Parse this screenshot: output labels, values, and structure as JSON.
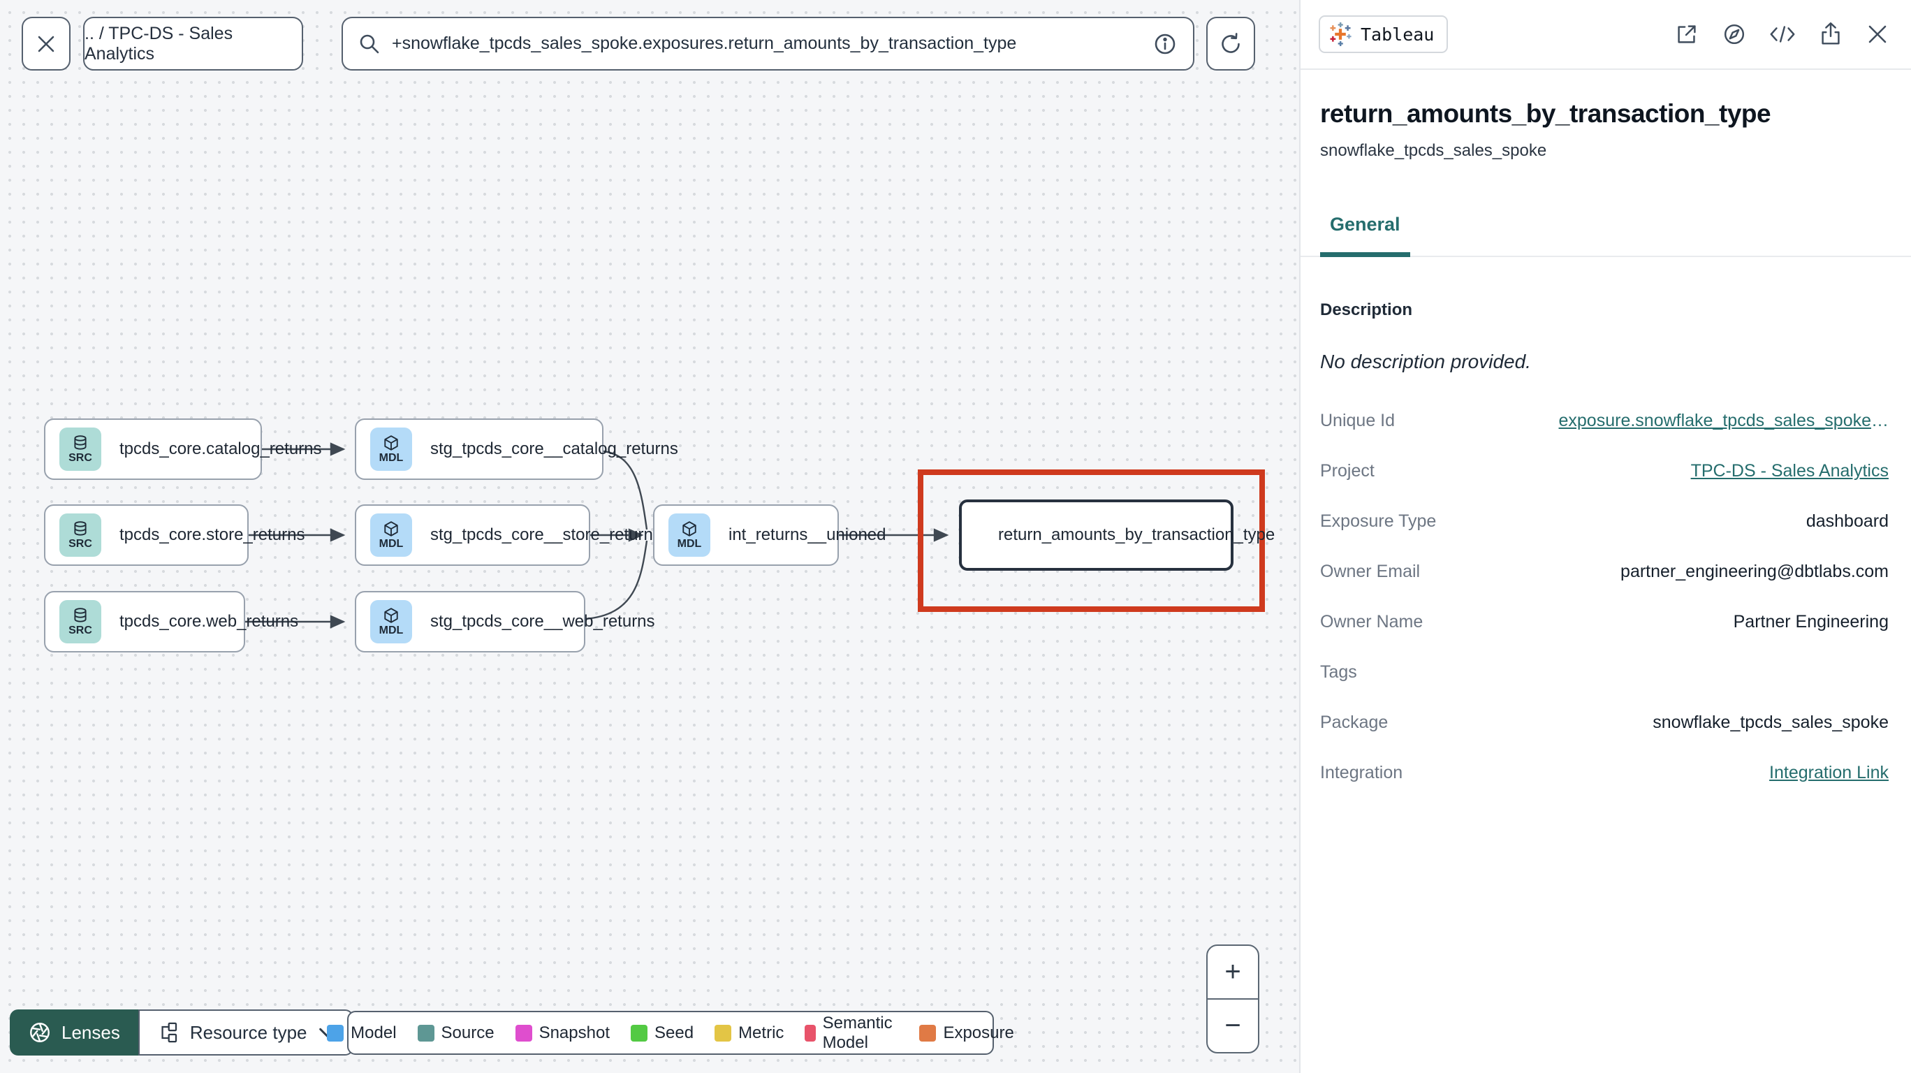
{
  "toolbar": {
    "breadcrumb": ".. / TPC-DS - Sales Analytics",
    "search_value": "+snowflake_tpcds_sales_spoke.exposures.return_amounts_by_transaction_type"
  },
  "graph": {
    "nodes": [
      {
        "badge": "SRC",
        "label": "tpcds_core.catalog_returns"
      },
      {
        "badge": "SRC",
        "label": "tpcds_core.store_returns"
      },
      {
        "badge": "SRC",
        "label": "tpcds_core.web_returns"
      },
      {
        "badge": "MDL",
        "label": "stg_tpcds_core__catalog_returns"
      },
      {
        "badge": "MDL",
        "label": "stg_tpcds_core__store_returns"
      },
      {
        "badge": "MDL",
        "label": "stg_tpcds_core__web_returns"
      },
      {
        "badge": "MDL",
        "label": "int_returns__unioned"
      }
    ],
    "exposure_node": {
      "label": "return_amounts_by_transaction_type",
      "icon": "tableau-logo"
    },
    "highlight_color": "#cf3a1e"
  },
  "controls": {
    "lenses_label": "Lenses",
    "resource_type_label": "Resource type",
    "zoom_in": "+",
    "zoom_out": "−"
  },
  "legend": {
    "items": [
      {
        "label": "Model",
        "color": "#4da3e8"
      },
      {
        "label": "Source",
        "color": "#5e9794"
      },
      {
        "label": "Snapshot",
        "color": "#df4ece"
      },
      {
        "label": "Seed",
        "color": "#53ca43"
      },
      {
        "label": "Metric",
        "color": "#e3c545"
      },
      {
        "label": "Semantic Model",
        "color": "#e8536a"
      },
      {
        "label": "Exposure",
        "color": "#e07a45"
      }
    ]
  },
  "panel": {
    "badge_label": "Tableau",
    "title": "return_amounts_by_transaction_type",
    "subtitle": "snowflake_tpcds_sales_spoke",
    "tab_label": "General",
    "description_label": "Description",
    "description_empty": "No description provided.",
    "accent_color": "#256d6d",
    "fields": [
      {
        "label": "Unique Id",
        "value": "exposure.snowflake_tpcds_sales_spoke",
        "ellipsis": "…"
      },
      {
        "label": "Project",
        "value": "TPC-DS - Sales Analytics"
      },
      {
        "label": "Exposure Type",
        "value": "dashboard"
      },
      {
        "label": "Owner Email",
        "value": "partner_engineering@dbtlabs.com"
      },
      {
        "label": "Owner Name",
        "value": "Partner Engineering"
      },
      {
        "label": "Tags",
        "value": ""
      },
      {
        "label": "Package",
        "value": "snowflake_tpcds_sales_spoke"
      },
      {
        "label": "Integration",
        "value": "Integration Link"
      }
    ]
  }
}
